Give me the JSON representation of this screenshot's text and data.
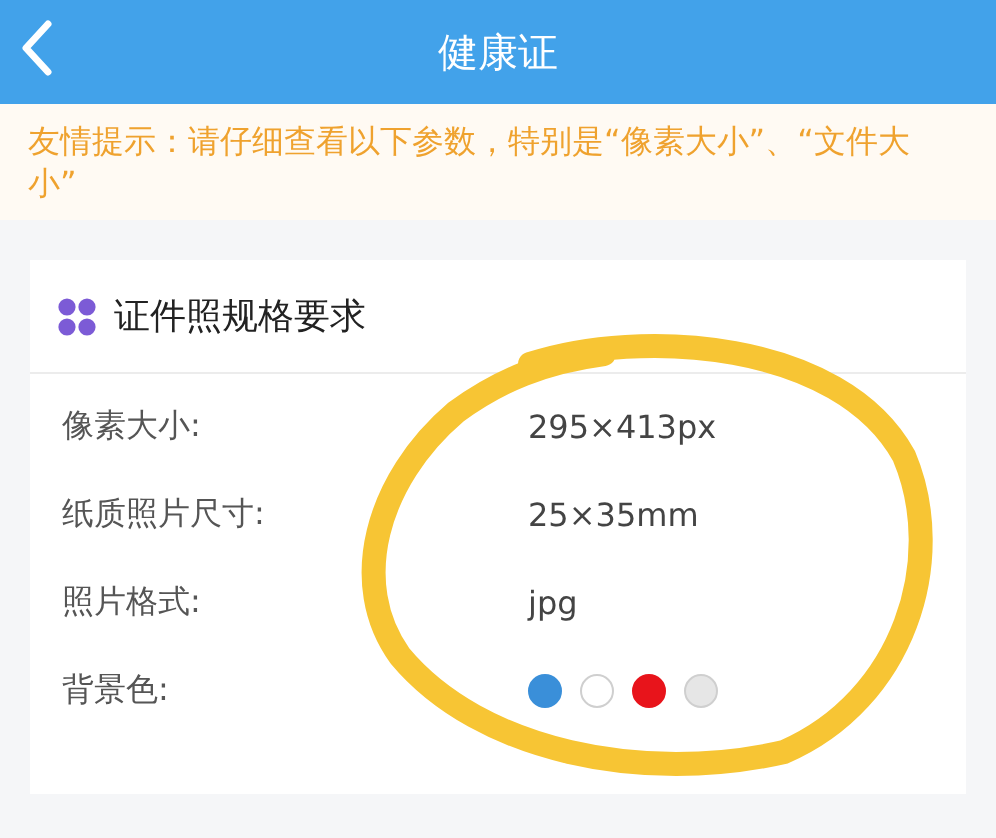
{
  "header": {
    "title": "健康证"
  },
  "tip": "友情提示：请仔细查看以下参数，特别是“像素大小”、“文件大小”",
  "card": {
    "title": "证件照规格要求",
    "rows": [
      {
        "kind": "text",
        "label": "像素大小:",
        "value": "295×413px"
      },
      {
        "kind": "text",
        "label": "纸质照片尺寸:",
        "value": "25×35mm"
      },
      {
        "kind": "text",
        "label": "照片格式:",
        "value": "jpg"
      },
      {
        "kind": "colors",
        "label": "背景色:",
        "colors": [
          {
            "color": "#3a8fd9"
          },
          {
            "color": "#ffffff"
          },
          {
            "color": "#e8141b"
          },
          {
            "color": "#e6e6e6"
          }
        ]
      }
    ]
  },
  "annotation": {
    "kind": "marker-circle"
  }
}
